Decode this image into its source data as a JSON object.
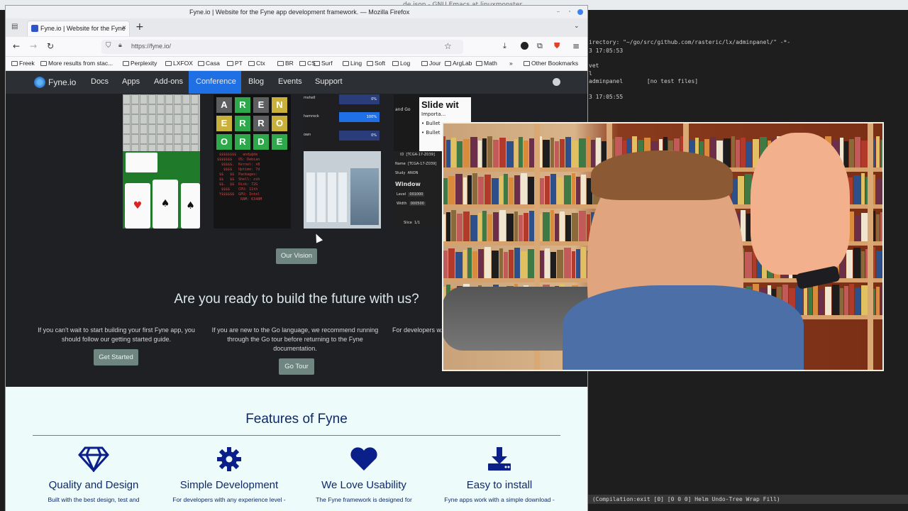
{
  "emacs": {
    "title": "de.json - GNU Emacs at linuxmonster",
    "lines": [
      "irectory: \"~/go/src/github.com/rasteric/lx/adminpanel/\" -*-",
      "3 17:05:53",
      "",
      "vet",
      "l",
      "adminpanel       [no test files]",
      "",
      "3 17:05:55"
    ],
    "modeline": " (Compilation:exit [0] [0 0 0] Helm Undo-Tree Wrap Fill)"
  },
  "firefox": {
    "window_title": "Fyne.io | Website for the Fyne app development framework. — Mozilla Firefox",
    "tab_title": "Fyne.io | Website for the Fyne",
    "url": "https://fyne.io/",
    "bookmarks": [
      "Freek",
      "More results from stac...",
      "Perplexity",
      "LXFOX",
      "Casa",
      "PT",
      "Ctx",
      "BR",
      "CS",
      "Surf",
      "Ling",
      "Soft",
      "Log",
      "Jour",
      "ArgLab",
      "Math"
    ],
    "other_bookmarks": "Other Bookmarks"
  },
  "site": {
    "brand": "Fyne.io",
    "nav": [
      "Docs",
      "Apps",
      "Add-ons",
      "Conference",
      "Blog",
      "Events",
      "Support"
    ],
    "active_nav": "Conference",
    "wordle_letters": [
      "A",
      "R",
      "E",
      "N",
      "E",
      "R",
      "R",
      "O",
      "O",
      "R",
      "D",
      "E"
    ],
    "shell_rows": [
      {
        "label": "mshell",
        "value": "0%"
      },
      {
        "label": "hamrock",
        "value": "100%"
      },
      {
        "label": "own",
        "value": "0%"
      }
    ],
    "slide_title": "Slide wit",
    "slide_lines": [
      "Importa...",
      "Bullet",
      "Bullet"
    ],
    "dicom": {
      "and_go": "and Go",
      "id_label": "ID",
      "id_value": "[TCGA-17-Z039]",
      "name_label": "Name",
      "name_value": "[TCGA-17-Z039]",
      "study_label": "Study",
      "study_value": "ANON",
      "window_label": "Window",
      "level_label": "Level",
      "level_value": "001000",
      "width_label": "Width",
      "width_value": "000500",
      "slice_label": "Slice",
      "slice_value": "1/1"
    },
    "vision_button": "Our Vision",
    "ready_heading": "Are you ready to build the future with us?",
    "columns": [
      {
        "text": "If you can't wait to start building your first Fyne app, you should follow our getting started guide.",
        "button": "Get Started"
      },
      {
        "text": "If you are new to the Go language, we recommend running through the Go tour before returning to the Fyne documentation.",
        "button": "Go Tour"
      },
      {
        "text": "For developers w... collection of ...",
        "button": ""
      }
    ],
    "features_heading": "Features of Fyne",
    "features": [
      {
        "title": "Quality and Design",
        "desc": "Built with the best design, test and",
        "icon": "diamond-icon"
      },
      {
        "title": "Simple Development",
        "desc": "For developers with any experience level -",
        "icon": "gear-icon"
      },
      {
        "title": "We Love Usability",
        "desc": "The Fyne framework is designed for",
        "icon": "heart-icon"
      },
      {
        "title": "Easy to install",
        "desc": "Fyne apps work with a simple download -",
        "icon": "download-icon"
      }
    ]
  },
  "colors": {
    "accent": "#1f6fe5",
    "feature_blue": "#0f2a66",
    "button_green": "#6e8580"
  }
}
